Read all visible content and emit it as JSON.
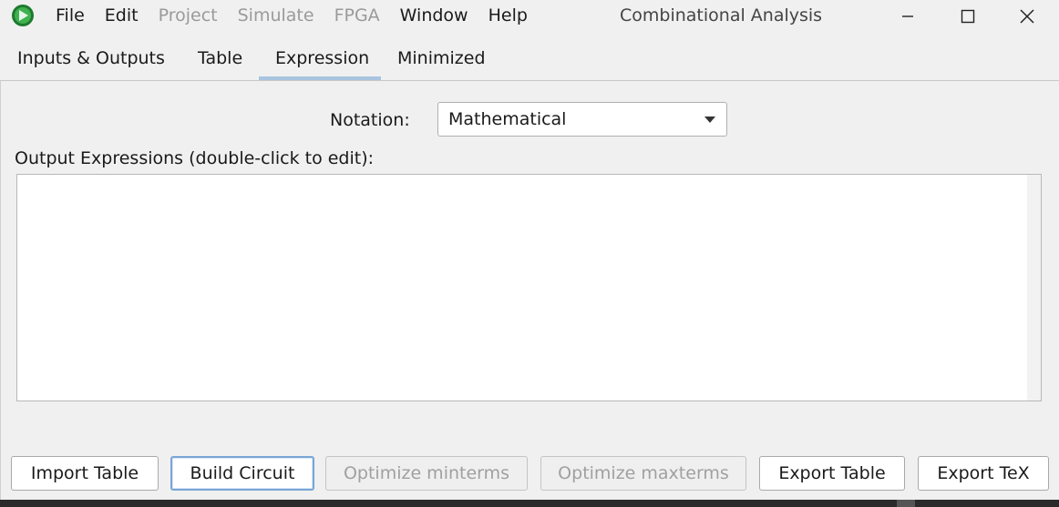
{
  "window": {
    "title": "Combinational Analysis",
    "accent": "#a8c4e0",
    "icon": "logisim-evolution-app-icon",
    "controls": [
      "minimize-icon",
      "maximize-icon",
      "close-icon"
    ]
  },
  "menu": {
    "items": [
      {
        "label": "File",
        "enabled": true
      },
      {
        "label": "Edit",
        "enabled": true
      },
      {
        "label": "Project",
        "enabled": false
      },
      {
        "label": "Simulate",
        "enabled": false
      },
      {
        "label": "FPGA",
        "enabled": false
      },
      {
        "label": "Window",
        "enabled": true
      },
      {
        "label": "Help",
        "enabled": true
      }
    ]
  },
  "tabs": [
    {
      "label": "Inputs & Outputs",
      "active": false
    },
    {
      "label": "Table",
      "active": false
    },
    {
      "label": "Expression",
      "active": true
    },
    {
      "label": "Minimized",
      "active": false
    }
  ],
  "notation": {
    "label": "Notation:",
    "selected": "Mathematical"
  },
  "expressions": {
    "label": "Output Expressions (double-click to edit):",
    "items": []
  },
  "buttons": [
    {
      "label": "Import Table",
      "enabled": true
    },
    {
      "label": "Build Circuit",
      "enabled": true,
      "focused": true
    },
    {
      "label": "Optimize minterms",
      "enabled": false
    },
    {
      "label": "Optimize maxterms",
      "enabled": false
    },
    {
      "label": "Export Table",
      "enabled": true
    },
    {
      "label": "Export TeX",
      "enabled": true
    }
  ]
}
